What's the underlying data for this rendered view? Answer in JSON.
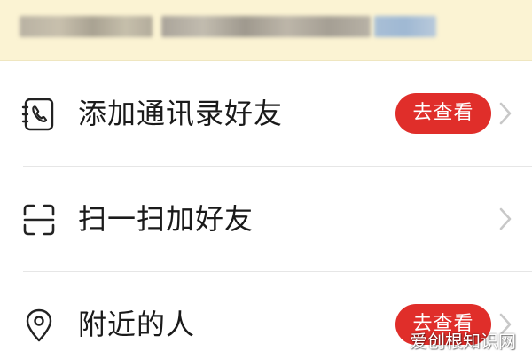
{
  "banner": {
    "blurred": true
  },
  "items": [
    {
      "label": "添加通讯录好友",
      "icon": "contacts-phone-icon",
      "action_label": "去查看"
    },
    {
      "label": "扫一扫加好友",
      "icon": "scan-icon",
      "action_label": ""
    },
    {
      "label": "附近的人",
      "icon": "location-pin-icon",
      "action_label": "去查看"
    }
  ],
  "colors": {
    "banner_bg": "#fbf3d3",
    "accent_red": "#e02e2a",
    "text_primary": "#1a1a1a",
    "chevron": "#c8c8c8",
    "divider": "#e6e6e6"
  },
  "watermark": {
    "text": "爱创根知识网"
  }
}
